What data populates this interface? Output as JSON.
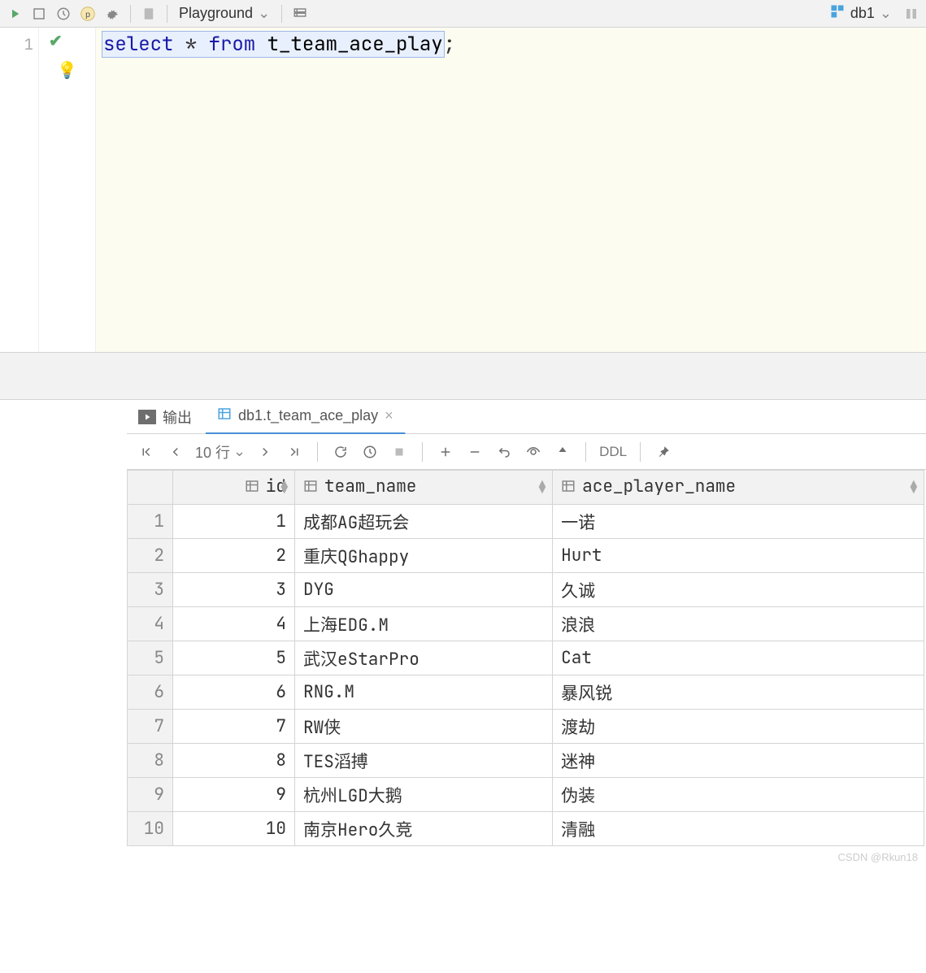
{
  "top_toolbar": {
    "playground_label": "Playground",
    "db_label": "db1"
  },
  "editor": {
    "line_number": "1",
    "sql": {
      "kw_select": "select",
      "star": " * ",
      "kw_from": "from",
      "space": " ",
      "table": "t_team_ace_play",
      "semicolon": ";"
    }
  },
  "result_tabs": {
    "output_label": "输出",
    "table_tab_label": "db1.t_team_ace_play"
  },
  "result_toolbar": {
    "rows_label": "10 行",
    "ddl_label": "DDL"
  },
  "columns": {
    "id": "id",
    "team_name": "team_name",
    "ace_player_name": "ace_player_name"
  },
  "rows": [
    {
      "n": "1",
      "id": "1",
      "team_name": "成都AG超玩会",
      "ace_player_name": "一诺"
    },
    {
      "n": "2",
      "id": "2",
      "team_name": "重庆QGhappy",
      "ace_player_name": "Hurt"
    },
    {
      "n": "3",
      "id": "3",
      "team_name": "DYG",
      "ace_player_name": "久诚"
    },
    {
      "n": "4",
      "id": "4",
      "team_name": "上海EDG.M",
      "ace_player_name": "浪浪"
    },
    {
      "n": "5",
      "id": "5",
      "team_name": "武汉eStarPro",
      "ace_player_name": "Cat"
    },
    {
      "n": "6",
      "id": "6",
      "team_name": "RNG.M",
      "ace_player_name": "暴风锐"
    },
    {
      "n": "7",
      "id": "7",
      "team_name": "RW侠",
      "ace_player_name": "渡劫"
    },
    {
      "n": "8",
      "id": "8",
      "team_name": "TES滔搏",
      "ace_player_name": "迷神"
    },
    {
      "n": "9",
      "id": "9",
      "team_name": "杭州LGD大鹅",
      "ace_player_name": "伪装"
    },
    {
      "n": "10",
      "id": "10",
      "team_name": "南京Hero久竞",
      "ace_player_name": "清融"
    }
  ],
  "watermark": "CSDN @Rkun18"
}
